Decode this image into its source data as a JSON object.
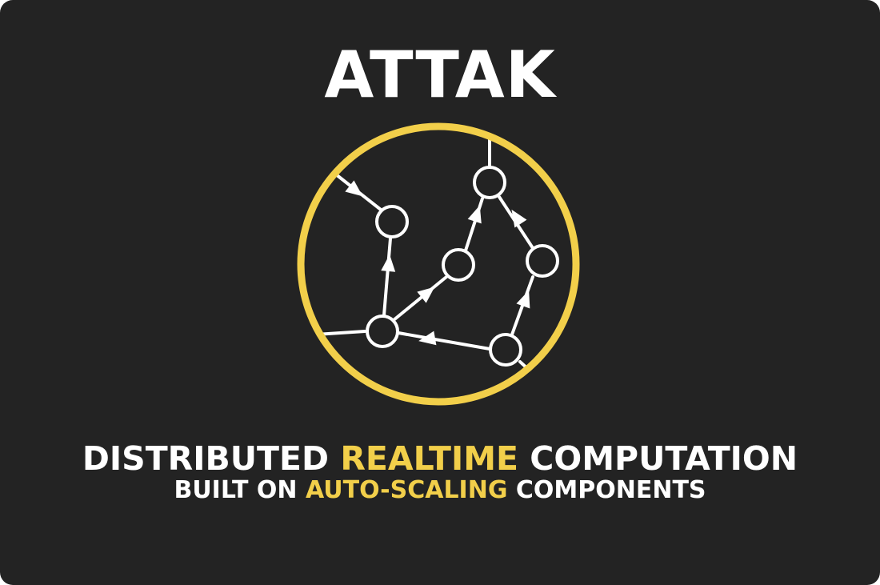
{
  "card": {
    "title": "ATTAK",
    "tagline_1": {
      "pre": "DISTRIBUTED ",
      "highlight": "REALTIME",
      "post": " COMPUTATION"
    },
    "tagline_2": {
      "pre": "BUILT ON ",
      "highlight": "AUTO-SCALING",
      "post": " COMPONENTS"
    }
  },
  "colors": {
    "background": "#232323",
    "text": "#ffffff",
    "accent": "#f2cf4a"
  },
  "icons": {
    "emblem": "topology-graph-icon"
  }
}
